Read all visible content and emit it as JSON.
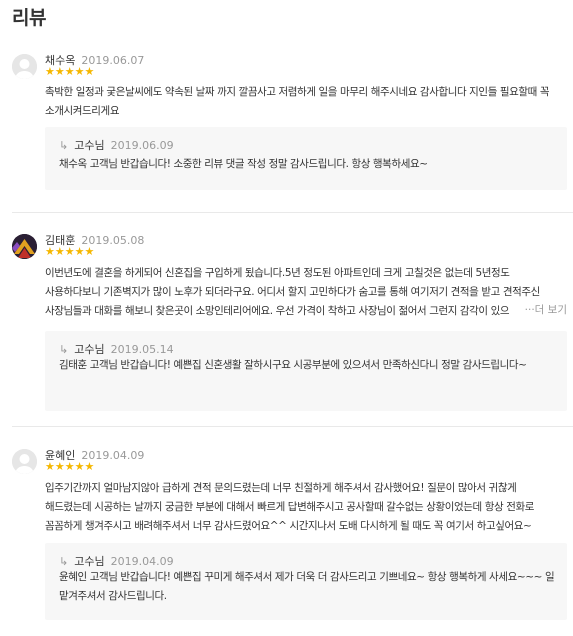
{
  "page": {
    "title": "리뷰"
  },
  "reviews": [
    {
      "name": "채수옥",
      "date": "2019.06.07",
      "stars": "★★★★★",
      "rating": 5,
      "text": "촉박한 일정과 궂은날씨에도 약속된 날짜 까지 깔끔사고 저렴하게 일을 마무리 해주시네요 감사합니다 지인들 필요할때 꼭 소개시켜드리게요",
      "avatar": "default-avatar-icon",
      "reply": {
        "name": "고수님",
        "date": "2019.06.09",
        "text": "채수옥 고객님 반갑습니다! 소중한 리뷰 댓글 작성 정말 감사드립니다. 항상 행복하세요~"
      }
    },
    {
      "name": "김태훈",
      "date": "2019.05.08",
      "stars": "★★★★★",
      "rating": 5,
      "text": "이번년도에 결혼을 하게되어 신혼집을 구입하게 됬습니다.5년 정도된 아파트인데 크게 고칠것은 없는데 5년정도 사용하다보니 기존벽지가 많이 노후가 되더라구요. 어디서 할지 고민하다가 숨고를 통해 여기저기 견적을 받고 견적주신 사장님들과 대화를 해보니 찾은곳이 소망인테리어에요. 우선 가격이 착하고 사장님이 젊어서 그런지 감각이 있으",
      "more_label": "···더 보기",
      "avatar": "profile-photo-icon",
      "reply": {
        "name": "고수님",
        "date": "2019.05.14",
        "text": "김태훈 고객님 반갑습니다! 예쁜집 신혼생활 잘하시구요 시공부분에 있으셔서 만족하신다니 정말 감사드립니다~"
      }
    },
    {
      "name": "윤혜인",
      "date": "2019.04.09",
      "stars": "★★★★★",
      "rating": 5,
      "text": "입주기간까지 얼마남지않아 급하게 견적 문의드렸는데 너무 친절하게 해주셔서 감사했어요! 질문이 많아서 귀찮게 해드렸는데 시공하는 날까지 궁금한 부분에 대해서 빠르게 답변해주시고 공사할때 갈수없는 상황이었는데 항상 전화로 꼼꼼하게 챙겨주시고 배려해주셔서 너무 감사드렸어요^^ 시간지나서 도배 다시하게 될 때도 꼭 여기서 하고싶어요~",
      "avatar": "default-avatar-icon",
      "reply": {
        "name": "고수님",
        "date": "2019.04.09",
        "text": "윤혜인 고객님 반갑습니다! 예쁜집 꾸미게 해주셔서 제가 더욱 더 감사드리고 기쁘네요~ 항상 행복하게 사세요~~~ 일 맡겨주셔서 감사드립니다."
      }
    }
  ]
}
